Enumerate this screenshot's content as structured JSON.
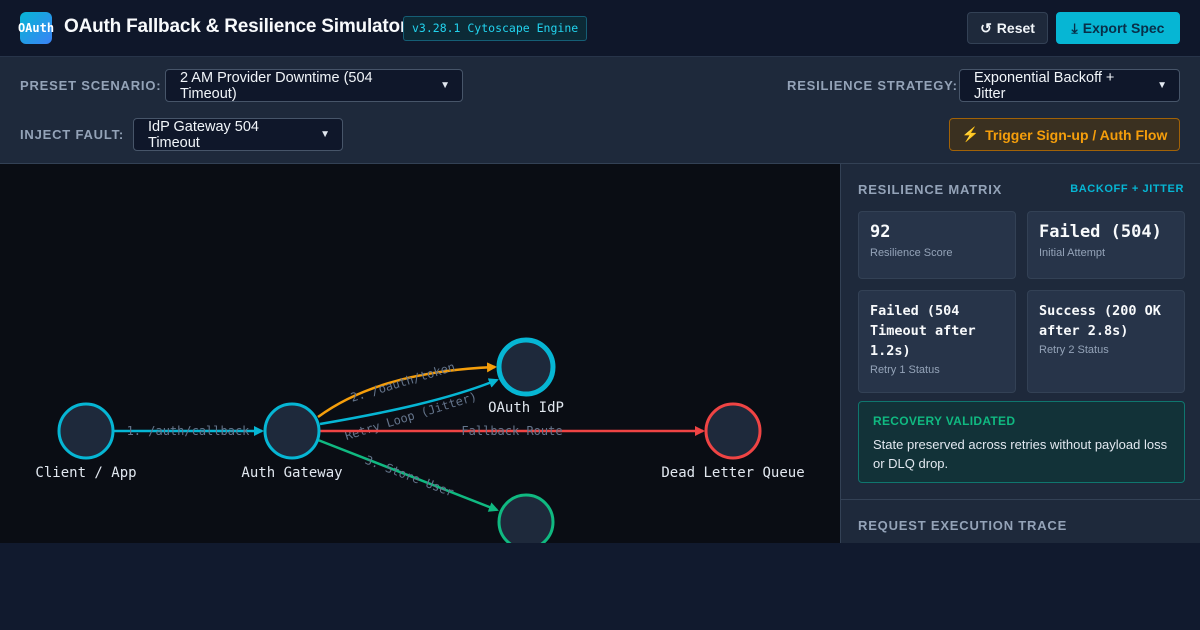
{
  "header": {
    "logo_text": "OAuth",
    "title": "OAuth Fallback & Resilience Simulator",
    "version": "v3.28.1 Cytoscape Engine",
    "reset_icon": "↺",
    "reset_label": "Reset",
    "export_icon": "⤓",
    "export_label": "Export Spec"
  },
  "controls": {
    "preset_label": "PRESET SCENARIO:",
    "preset_value": "2 AM Provider Downtime (504 Timeout)",
    "strategy_label": "RESILIENCE STRATEGY:",
    "strategy_value": "Exponential Backoff + Jitter",
    "fault_label": "INJECT FAULT:",
    "fault_value": "IdP Gateway 504 Timeout",
    "trigger_icon": "⚡",
    "trigger_label": "Trigger Sign-up / Auth Flow"
  },
  "graph": {
    "nodes": [
      {
        "id": "client",
        "label": "Client / App",
        "color": "#06b6d4"
      },
      {
        "id": "gateway",
        "label": "Auth Gateway",
        "color": "#06b6d4"
      },
      {
        "id": "idp",
        "label": "OAuth IdP",
        "color": "#06b6d4"
      },
      {
        "id": "dlq",
        "label": "Dead Letter Queue",
        "color": "#ef4444"
      },
      {
        "id": "userdb",
        "label": "",
        "color": "#10b981"
      }
    ],
    "edges": [
      {
        "from": "client",
        "to": "gateway",
        "label": "1. /auth/callback",
        "color": "#06b6d4"
      },
      {
        "from": "gateway",
        "to": "idp",
        "label": "2. /oauth/token",
        "color": "#f59e0b"
      },
      {
        "from": "gateway",
        "to": "idp",
        "label": "Retry Loop (Jitter)",
        "color": "#06b6d4"
      },
      {
        "from": "gateway",
        "to": "dlq",
        "label": "Fallback Route",
        "color": "#ef4444"
      },
      {
        "from": "gateway",
        "to": "userdb",
        "label": "3. Store User",
        "color": "#10b981"
      }
    ]
  },
  "matrix": {
    "title": "RESILIENCE MATRIX",
    "strategy_tag": "BACKOFF + JITTER",
    "cards": [
      {
        "value": "92",
        "caption": "Resilience Score"
      },
      {
        "value": "Failed (504)",
        "caption": "Initial Attempt"
      },
      {
        "value": "Failed (504 Timeout after 1.2s)",
        "caption": "Retry 1 Status"
      },
      {
        "value": "Success (200 OK after 2.8s)",
        "caption": "Retry 2 Status"
      }
    ],
    "recovery_title": "RECOVERY VALIDATED",
    "recovery_text": "State preserved across retries without payload loss or DLQ drop."
  },
  "trace": {
    "title": "REQUEST EXECUTION TRACE"
  }
}
